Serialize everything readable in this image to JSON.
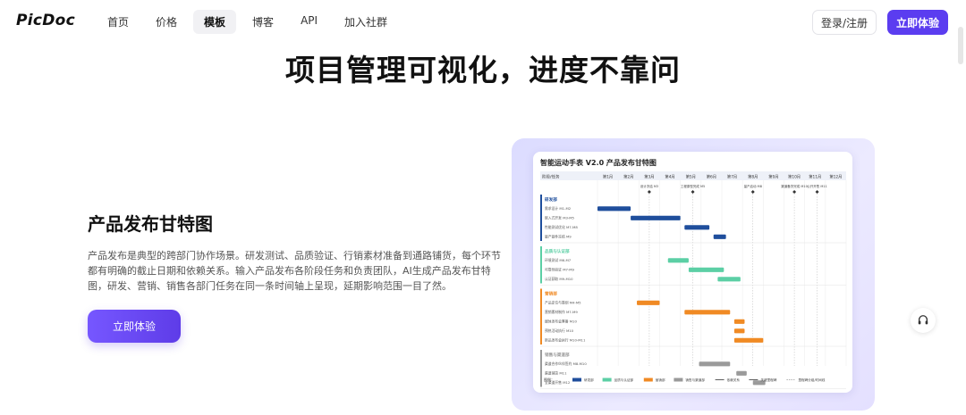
{
  "nav": {
    "logo": "PicDoc",
    "links": [
      "首页",
      "价格",
      "模板",
      "博客",
      "API",
      "加入社群"
    ],
    "active_index": 2,
    "login_label": "登录/注册",
    "try_label": "立即体验"
  },
  "headline": "项目管理可视化，进度不靠问",
  "section": {
    "title": "产品发布甘特图",
    "description": "产品发布是典型的跨部门协作场景。研发测试、品质验证、行销素材准备到通路铺货，每个环节都有明确的截止日期和依赖关系。输入产品发布各阶段任务和负责团队，AI生成产品发布甘特图，研发、营销、销售各部门任务在同一条时间轴上呈现，延期影响范围一目了然。",
    "button_label": "立即体验"
  },
  "gantt": {
    "title": "智能运动手表 V2.0 产品发布甘特图",
    "header_label": "阶段/任务",
    "months": [
      "第1月",
      "第2月",
      "第3月",
      "第4月",
      "第5月",
      "第6月",
      "第7月",
      "第8月",
      "第9月",
      "第10月",
      "第11月",
      "第12月"
    ],
    "milestones": [
      {
        "label": "设计冻结 M3",
        "month": 2.5
      },
      {
        "label": "工程原型完成 M5",
        "month": 4.6
      },
      {
        "label": "量产启动 M8",
        "month": 7.5
      },
      {
        "label": "渠道备货完成 M10",
        "month": 9.5
      },
      {
        "label": "公开开售 M11",
        "month": 10.6
      }
    ],
    "groups": [
      {
        "name": "研发部",
        "color": "#1f4e9c",
        "tasks": [
          {
            "label": "需求设计 M1-M2",
            "start": 0,
            "end": 1.6
          },
          {
            "label": "嵌入式开发 M3-M5",
            "start": 1.6,
            "end": 4.0
          },
          {
            "label": "性能测试优化 M7-M8",
            "start": 4.2,
            "end": 5.4
          },
          {
            "label": "量产固件冻结 M9",
            "start": 5.6,
            "end": 6.2
          }
        ]
      },
      {
        "name": "品质与认证部",
        "color": "#5ccfa5",
        "tasks": [
          {
            "label": "环境测试 M6-M7",
            "start": 3.4,
            "end": 4.4
          },
          {
            "label": "可靠性验证 M7-M9",
            "start": 4.4,
            "end": 6.1
          },
          {
            "label": "认证获取 M9-M10",
            "start": 5.8,
            "end": 6.9
          }
        ]
      },
      {
        "name": "营销部",
        "color": "#f08a24",
        "tasks": [
          {
            "label": "产品定位与策划 M4-M5",
            "start": 1.9,
            "end": 3.0
          },
          {
            "label": "营销素材制作 M7-M9",
            "start": 4.2,
            "end": 6.4
          },
          {
            "label": "媒体发布会筹备 M10",
            "start": 6.6,
            "end": 7.1
          },
          {
            "label": "预热活动执行 M10",
            "start": 6.6,
            "end": 7.1
          },
          {
            "label": "新品发布会执行 M10-M11",
            "start": 6.6,
            "end": 8.0
          }
        ]
      },
      {
        "name": "销售与渠道部",
        "color": "#9a9a9a",
        "tasks": [
          {
            "label": "渠道合作伙伴签约 M8-M10",
            "start": 4.9,
            "end": 6.4
          },
          {
            "label": "渠道铺货 M11",
            "start": 6.7,
            "end": 7.2
          },
          {
            "label": "全渠道开售 M12",
            "start": 7.5,
            "end": 8.1
          }
        ]
      }
    ],
    "legend": [
      {
        "label": "研发部",
        "color": "#1f4e9c"
      },
      {
        "label": "品质与认证部",
        "color": "#5ccfa5"
      },
      {
        "label": "营销部",
        "color": "#f08a24"
      },
      {
        "label": "销售与渠道部",
        "color": "#9a9a9a"
      },
      {
        "label": "依赖关系",
        "color": "#333333"
      },
      {
        "label": "关键里程碑",
        "color": "#333333"
      },
      {
        "label": "里程碑分组/时间线",
        "color": "#999999"
      }
    ],
    "legend_title": "图例："
  }
}
